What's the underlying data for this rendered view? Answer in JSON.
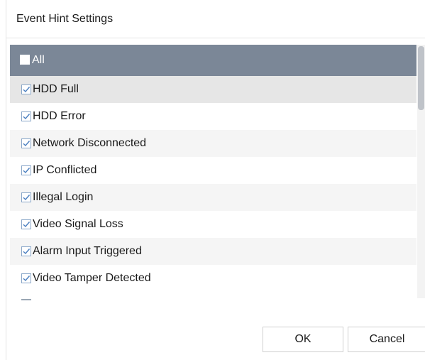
{
  "dialog": {
    "title": "Event Hint Settings"
  },
  "list": {
    "header_label": "All",
    "header_checked": false,
    "items": [
      {
        "label": "HDD Full",
        "checked": true
      },
      {
        "label": "HDD Error",
        "checked": true
      },
      {
        "label": "Network Disconnected",
        "checked": true
      },
      {
        "label": "IP Conflicted",
        "checked": true
      },
      {
        "label": "Illegal Login",
        "checked": true
      },
      {
        "label": "Video Signal Loss",
        "checked": true
      },
      {
        "label": "Alarm Input Triggered",
        "checked": true
      },
      {
        "label": "Video Tamper Detected",
        "checked": true
      }
    ]
  },
  "buttons": {
    "ok_label": "OK",
    "cancel_label": "Cancel"
  },
  "colors": {
    "header_bg": "#7b8797",
    "checkbox_border": "#8aa7c9",
    "checkmark": "#4a7fc0"
  }
}
